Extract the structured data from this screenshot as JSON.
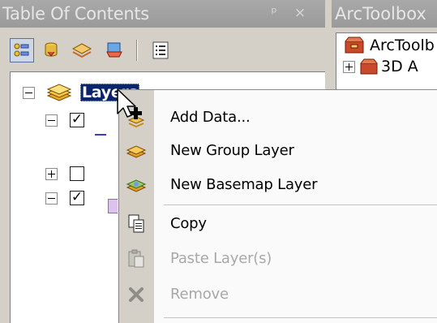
{
  "toc": {
    "title": "Table Of Contents",
    "pin_glyph": "ᵖ",
    "close_glyph": "×",
    "toolbar": [
      {
        "name": "list-by-drawing-order",
        "icon": "list-by-drawing-order-icon",
        "active": true
      },
      {
        "name": "list-by-source",
        "icon": "list-by-source-icon"
      },
      {
        "name": "list-by-visibility",
        "icon": "list-by-visibility-icon"
      },
      {
        "name": "list-by-selection",
        "icon": "list-by-selection-icon"
      },
      {
        "name": "options",
        "icon": "options-icon"
      }
    ],
    "root_layer": {
      "label": "Layers",
      "expanded": true
    },
    "layers": [
      {
        "expanded": true,
        "checked": true
      },
      {
        "expanded": false,
        "checked": false
      },
      {
        "expanded": true,
        "checked": true
      }
    ],
    "check_glyph": "✓"
  },
  "arctoolbox": {
    "title": "ArcToolbox",
    "root_label": "ArcToolb",
    "items": [
      {
        "label": "3D A",
        "expanded": false
      }
    ]
  },
  "context_menu": {
    "items": [
      {
        "label": "Add Data...",
        "icon": "add-data-icon",
        "enabled": true
      },
      {
        "label": "New Group Layer",
        "icon": "new-group-layer-icon",
        "enabled": true
      },
      {
        "label": "New Basemap Layer",
        "icon": "new-basemap-layer-icon",
        "enabled": true
      },
      {
        "label": "Copy",
        "icon": "copy-icon",
        "enabled": true
      },
      {
        "label": "Paste Layer(s)",
        "icon": "paste-icon",
        "enabled": false
      },
      {
        "label": "Remove",
        "icon": "remove-icon",
        "enabled": false
      }
    ]
  },
  "colors": {
    "selection": "#0a246a",
    "titlebar": "#a0a0a0",
    "face": "#d4d0c8",
    "disabled_text": "#a8a8a8"
  }
}
